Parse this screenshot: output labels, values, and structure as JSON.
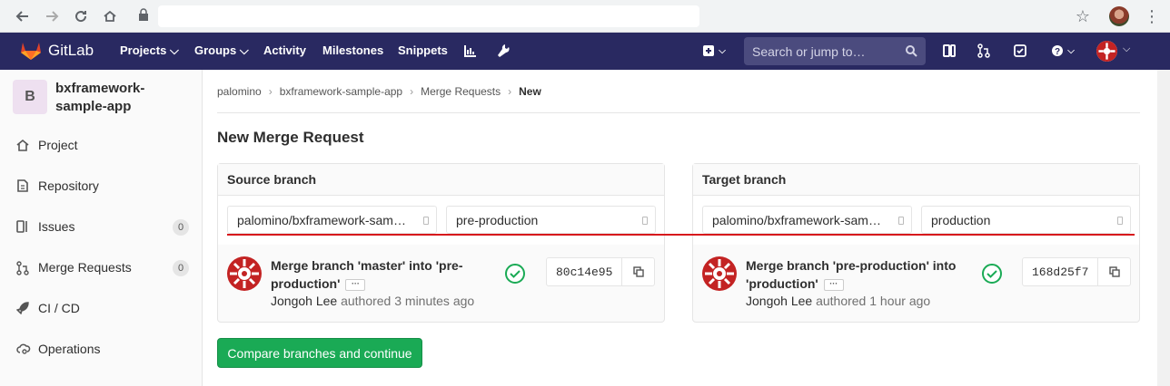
{
  "browser": {
    "back_icon": "back-arrow-icon",
    "forward_icon": "forward-arrow-icon",
    "reload_icon": "reload-icon",
    "home_icon": "home-icon",
    "url": ""
  },
  "navbar": {
    "brand": "GitLab",
    "links": [
      "Projects",
      "Groups",
      "Activity",
      "Milestones",
      "Snippets"
    ],
    "search_placeholder": "Search or jump to…",
    "bg_color": "#292961"
  },
  "sidebar": {
    "project_initial": "B",
    "project_name": "bxframework-sample-app",
    "items": [
      {
        "label": "Project",
        "icon": "home-icon"
      },
      {
        "label": "Repository",
        "icon": "doc-icon"
      },
      {
        "label": "Issues",
        "icon": "issues-icon",
        "badge": "0"
      },
      {
        "label": "Merge Requests",
        "icon": "merge-request-icon",
        "badge": "0"
      },
      {
        "label": "CI / CD",
        "icon": "rocket-icon"
      },
      {
        "label": "Operations",
        "icon": "cloud-gear-icon"
      }
    ]
  },
  "breadcrumb": {
    "items": [
      "palomino",
      "bxframework-sample-app",
      "Merge Requests"
    ],
    "current": "New"
  },
  "page_title": "New Merge Request",
  "source": {
    "header": "Source branch",
    "project": "palomino/bxframework-sam…",
    "branch": "pre-production",
    "commit_title_line1": "Merge branch 'master' into 'pre-",
    "commit_title_line2": "production'",
    "author": "Jongoh Lee",
    "authored": "authored 3 minutes ago",
    "sha": "80c14e95"
  },
  "target": {
    "header": "Target branch",
    "project": "palomino/bxframework-sam…",
    "branch": "production",
    "commit_title_line1": "Merge branch 'pre-production' into",
    "commit_title_line2": "'production'",
    "author": "Jongoh Lee",
    "authored": "authored 1 hour ago",
    "sha": "168d25f7"
  },
  "compare_button": "Compare branches and continue",
  "colors": {
    "success": "#1aaa55",
    "annotation_line": "#d7181c"
  }
}
